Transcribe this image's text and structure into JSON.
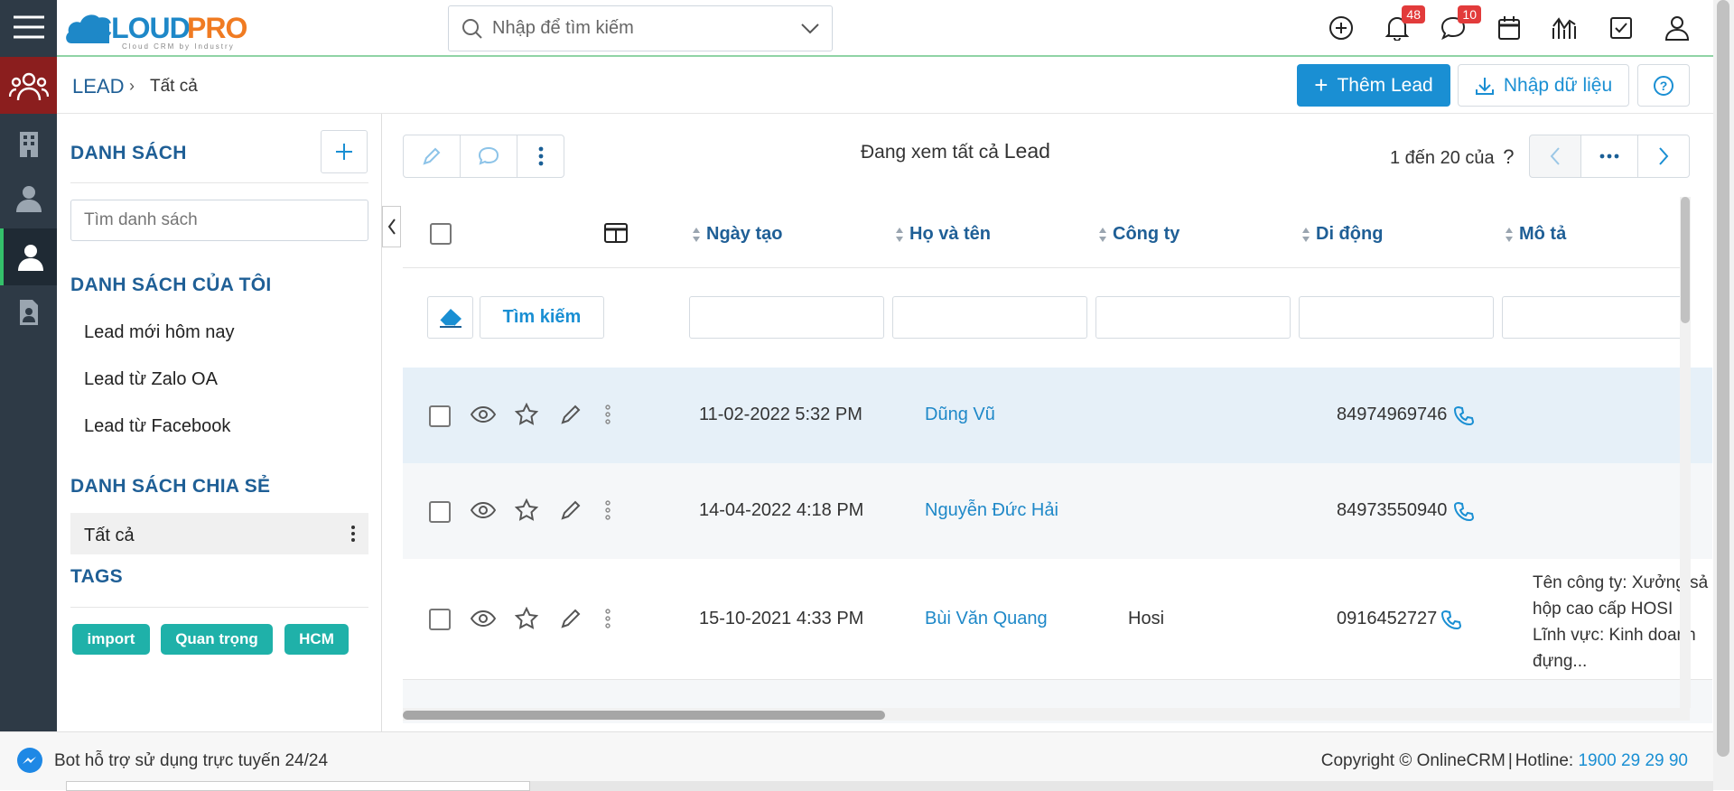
{
  "app": {
    "logo_text": "CLOUDPRO",
    "logo_tagline": "Cloud CRM by Industry"
  },
  "search": {
    "placeholder": "Nhập để tìm kiếm"
  },
  "notifications": {
    "count": "48"
  },
  "messages": {
    "count": "10"
  },
  "breadcrumb": {
    "module": "LEAD",
    "separator": "›",
    "current": "Tất cả"
  },
  "header_buttons": {
    "add_lead": "Thêm Lead",
    "import": "Nhập dữ liệu"
  },
  "sidebar": {
    "lists_title": "DANH SÁCH",
    "search_placeholder": "Tìm danh sách",
    "my_lists_title": "DANH SÁCH CỦA TÔI",
    "my_lists": [
      "Lead mới hôm nay",
      "Lead từ Zalo OA",
      "Lead từ Facebook"
    ],
    "shared_title": "DANH SÁCH CHIA SẺ",
    "shared": [
      "Tất cả"
    ],
    "tags_title": "TAGS",
    "tags": [
      "import",
      "Quan trọng",
      "HCM"
    ]
  },
  "view": {
    "viewing_prefix": "Đang xem tất cả",
    "viewing_module": "Lead",
    "pagination": "1 đến 20 của",
    "pagination_total": "?"
  },
  "table": {
    "columns": [
      "Ngày tạo",
      "Họ và tên",
      "Công ty",
      "Di động",
      "Mô tả"
    ],
    "search_button": "Tìm kiếm",
    "rows": [
      {
        "created": "11-02-2022 5:32 PM",
        "name": "Dũng Vũ",
        "company": "",
        "mobile": "84974969746",
        "desc": ""
      },
      {
        "created": "14-04-2022 4:18 PM",
        "name": "Nguyễn Đức Hải",
        "company": "",
        "mobile": "84973550940",
        "desc": ""
      },
      {
        "created": "15-10-2021 4:33 PM",
        "name": "Bùi Văn Quang",
        "company": "Hosi",
        "mobile": "0916452727",
        "desc_lines": [
          "Tên công ty: Xưởng sả",
          "hộp cao cấp HOSI",
          "Lĩnh vực: Kinh doanh",
          "đựng..."
        ]
      }
    ]
  },
  "footer": {
    "bot_text": "Bot hỗ trợ sử dụng trực tuyến 24/24",
    "copyright": "Copyright © OnlineCRM",
    "hotline_label": "Hotline:",
    "hotline_number": "1900 29 29 90"
  },
  "colors": {
    "primary": "#1a8fd3",
    "heading": "#1f5f96",
    "rail": "#2e3a46",
    "rail_active": "#8b1e1e",
    "tag": "#1fb1a9"
  }
}
